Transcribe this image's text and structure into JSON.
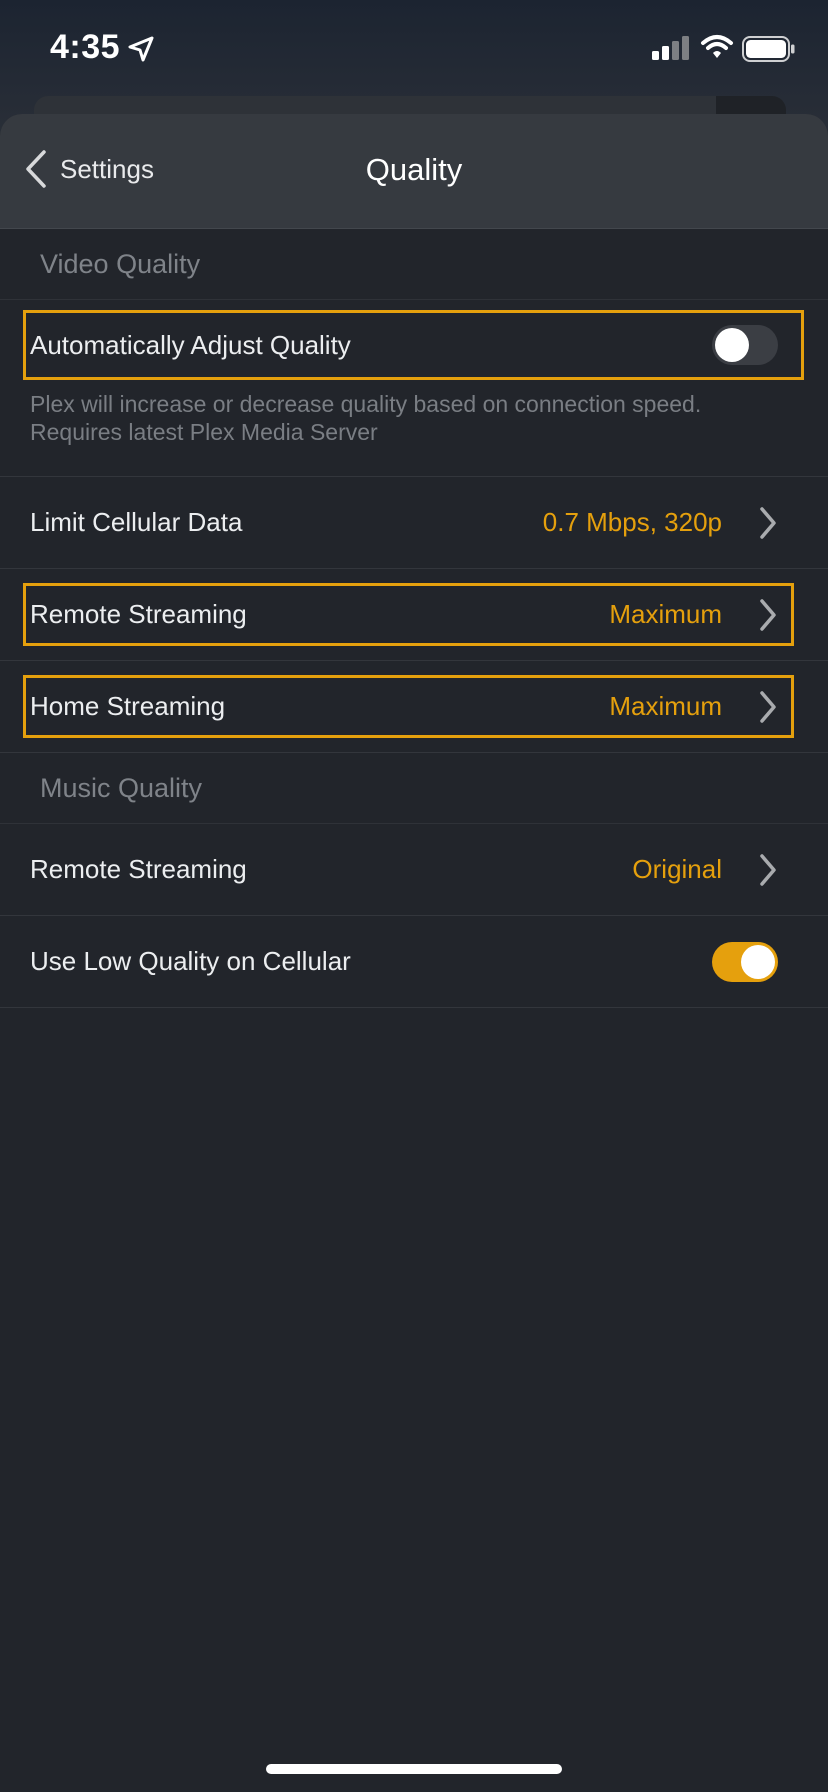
{
  "status_bar": {
    "time": "4:35",
    "icons": [
      "location-arrow-icon",
      "cellular-signal-icon",
      "wifi-icon",
      "battery-icon"
    ]
  },
  "nav": {
    "back_label": "Settings",
    "title": "Quality"
  },
  "colors": {
    "accent": "#e5a00d",
    "background": "#22252b",
    "nav_background": "#363a40"
  },
  "video_quality": {
    "header": "Video Quality",
    "auto_adjust": {
      "label": "Automatically Adjust Quality",
      "enabled": false,
      "description": "Plex will increase or decrease quality based on connection speed. Requires latest Plex Media Server"
    },
    "limit_cellular": {
      "label": "Limit Cellular Data",
      "value": "0.7 Mbps, 320p"
    },
    "remote_streaming": {
      "label": "Remote Streaming",
      "value": "Maximum"
    },
    "home_streaming": {
      "label": "Home Streaming",
      "value": "Maximum"
    }
  },
  "music_quality": {
    "header": "Music Quality",
    "remote_streaming": {
      "label": "Remote Streaming",
      "value": "Original"
    },
    "low_quality_cellular": {
      "label": "Use Low Quality on Cellular",
      "enabled": true
    }
  }
}
